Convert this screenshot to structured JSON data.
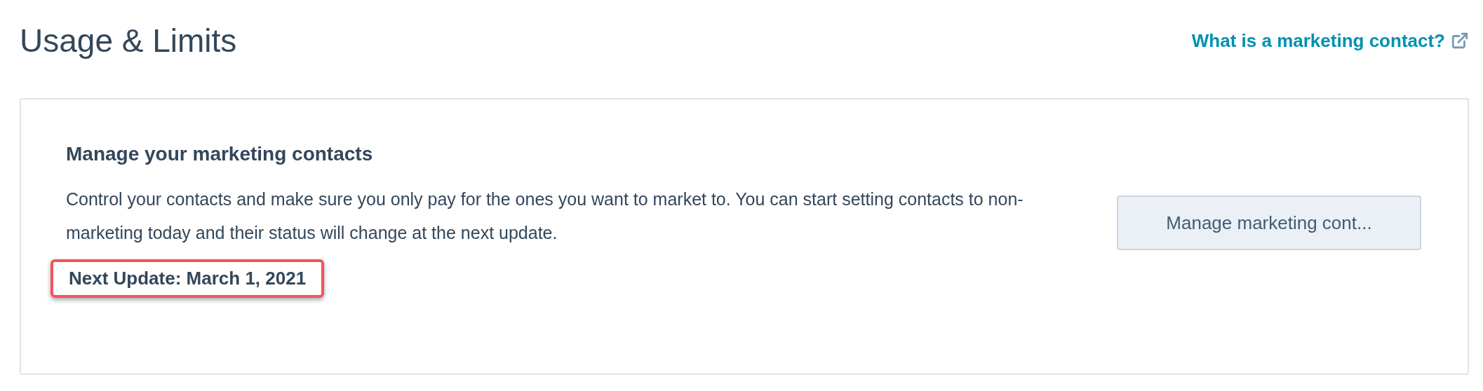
{
  "page": {
    "title": "Usage & Limits",
    "help_link": "What is a marketing contact?"
  },
  "card": {
    "heading": "Manage your marketing contacts",
    "description": "Control your contacts and make sure you only pay for the ones you want to market to. You can start setting contacts to non-marketing today and their status will change at the next update.",
    "next_update": {
      "text": "Next Update: March 1, 2021",
      "highlighted": true
    },
    "button": "Manage marketing cont..."
  }
}
